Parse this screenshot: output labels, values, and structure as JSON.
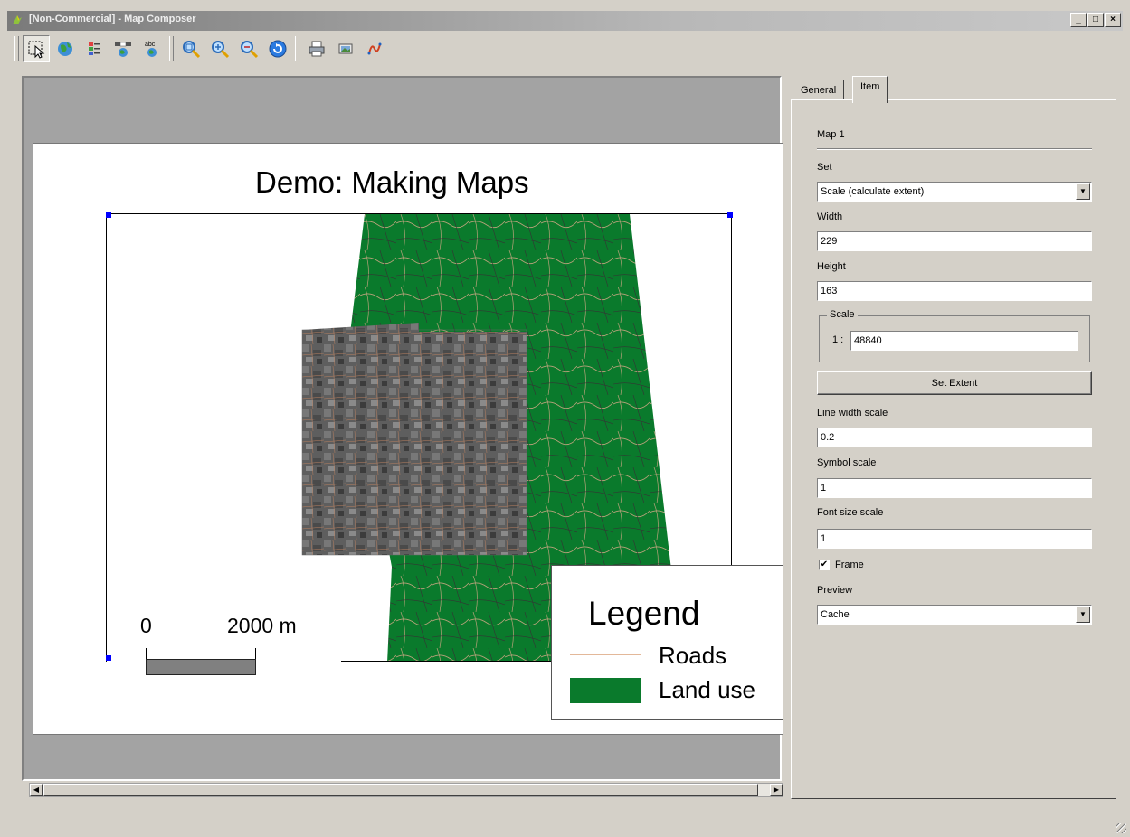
{
  "window": {
    "title": "[Non-Commercial] - Map Composer",
    "buttons": [
      "_",
      "□",
      "×"
    ]
  },
  "toolbar": {
    "icons": [
      "select-move-icon",
      "add-map-icon",
      "add-vector-legend-icon",
      "add-scalebar-icon",
      "add-label-icon",
      "zoom-full-icon",
      "zoom-in-icon",
      "zoom-out-icon",
      "refresh-icon",
      "print-icon",
      "export-image-icon",
      "export-svg-icon"
    ]
  },
  "composer": {
    "map_title": "Demo: Making Maps",
    "scalebar": {
      "left_label": "0",
      "right_label": "2000 m"
    },
    "legend": {
      "title": "Legend",
      "items": [
        {
          "label": "Roads",
          "color": "#e3b899"
        },
        {
          "label": "Land use",
          "color": "#0a7a2c"
        }
      ]
    }
  },
  "panel": {
    "tabs": [
      {
        "label": "General",
        "active": false
      },
      {
        "label": "Item",
        "active": true
      }
    ],
    "item_name": "Map 1",
    "set_label": "Set",
    "set_value": "Scale (calculate extent)",
    "width_label": "Width",
    "width_value": "229",
    "height_label": "Height",
    "height_value": "163",
    "scale_group_label": "Scale",
    "scale_prefix": "1 :",
    "scale_value": "48840",
    "set_extent_button": "Set Extent",
    "line_width_scale_label": "Line width scale",
    "line_width_scale_value": "0.2",
    "symbol_scale_label": "Symbol scale",
    "symbol_scale_value": "1",
    "font_size_scale_label": "Font size scale",
    "font_size_scale_value": "1",
    "frame_label": "Frame",
    "frame_checked": true,
    "preview_label": "Preview",
    "preview_value": "Cache"
  },
  "colors": {
    "land_use": "#0a7a2c",
    "roads": "#e3b899",
    "selection_handle": "#0000ff"
  }
}
